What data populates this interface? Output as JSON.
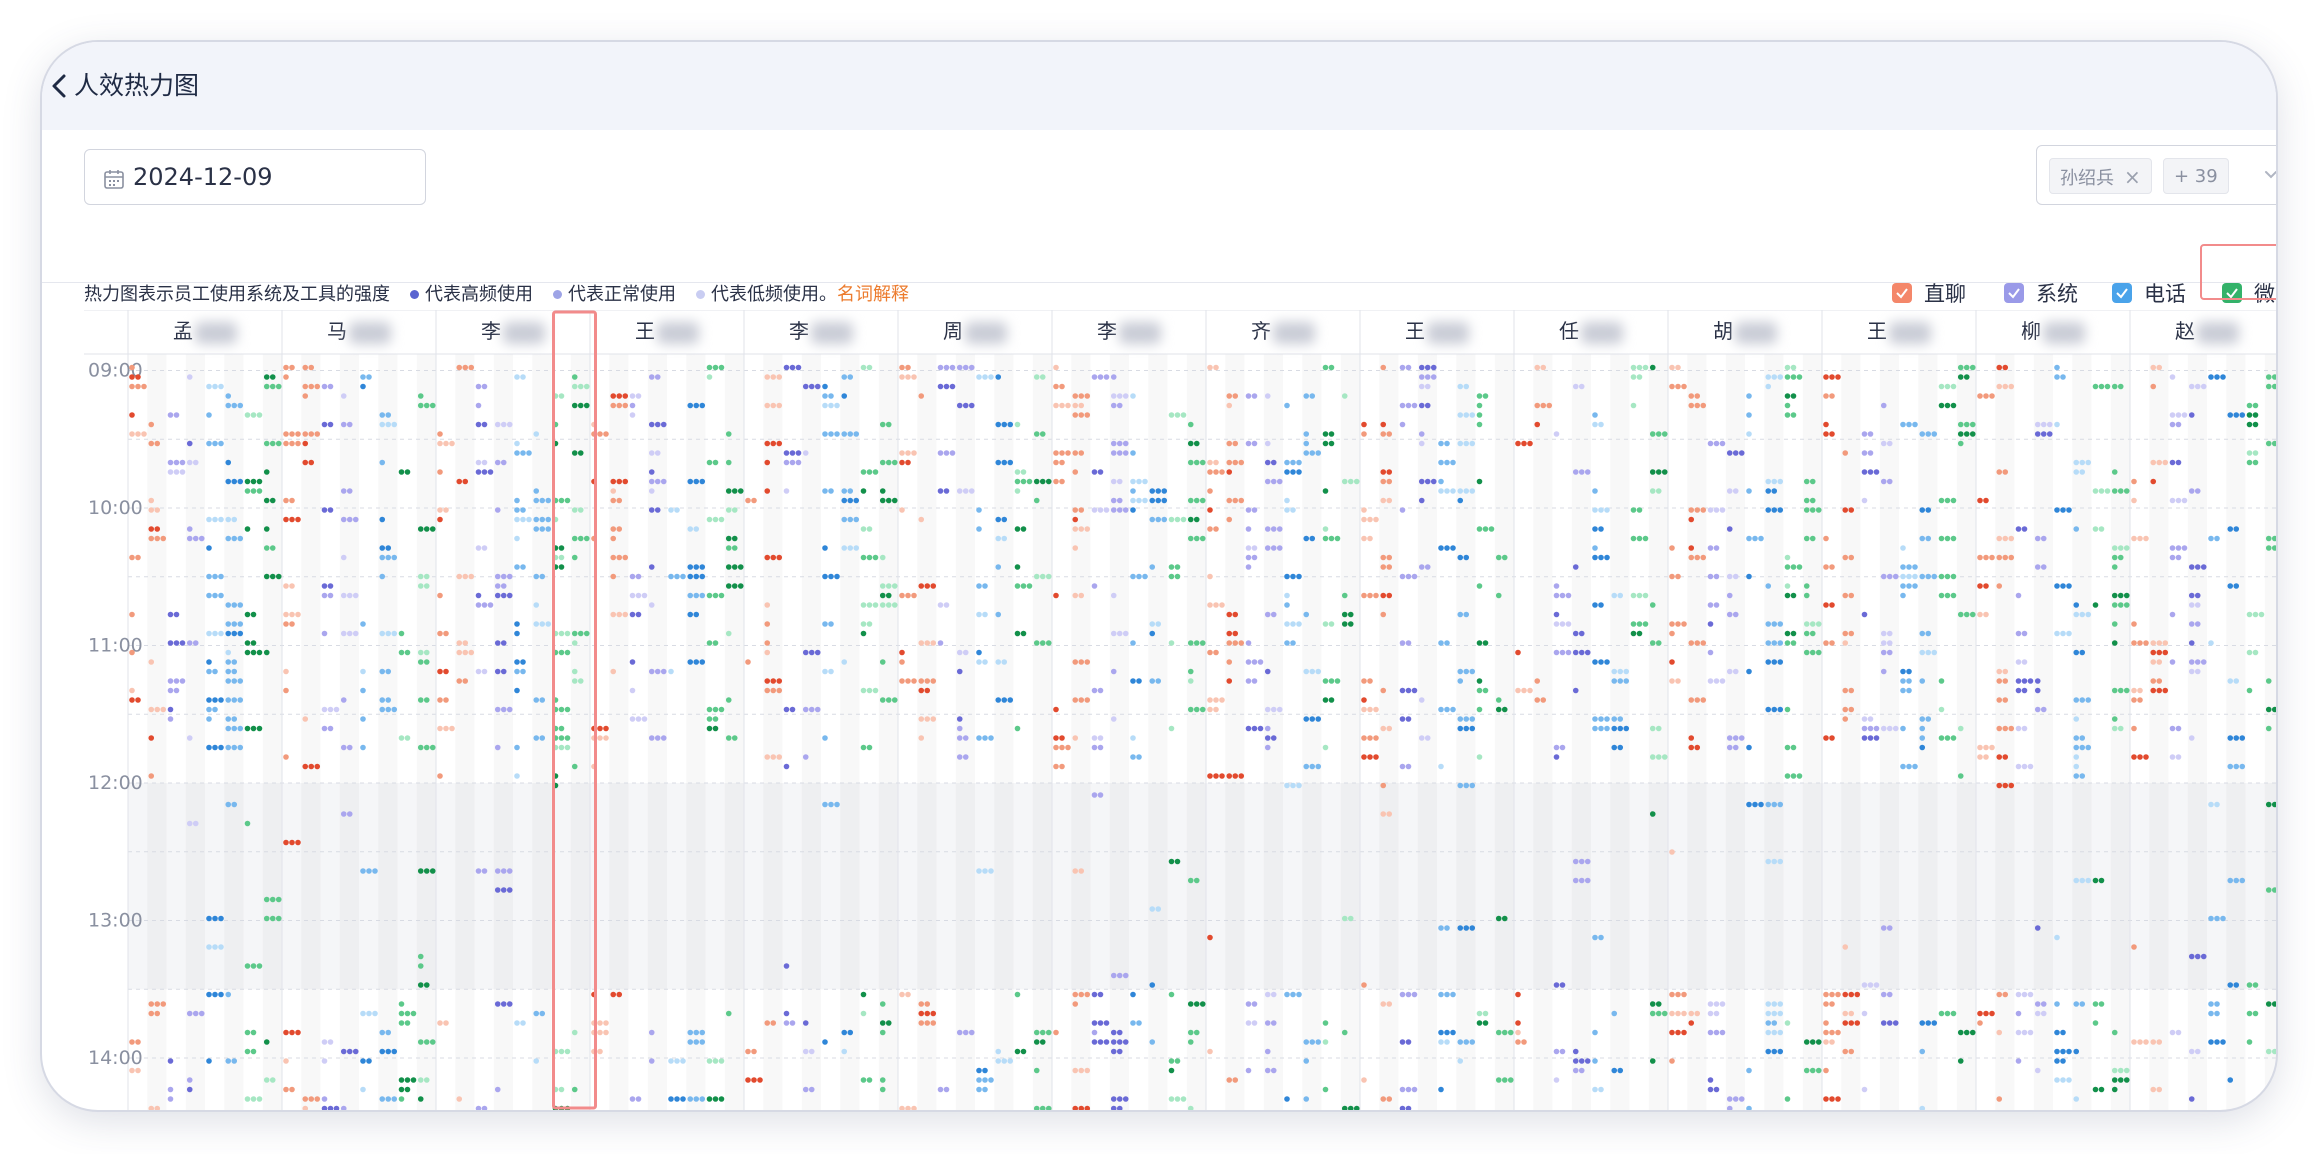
{
  "header": {
    "title": "人效热力图"
  },
  "toolbar": {
    "date": "2024-12-09",
    "staff_filter": {
      "selected_tag": "孙绍兵",
      "more_tag": "+ 39"
    }
  },
  "legend": {
    "intro": "热力图表示员工使用系统及工具的强度",
    "high": "代表高频使用",
    "normal": "代表正常使用",
    "low": "代表低频使用。",
    "term_link": "名词解释"
  },
  "categories": [
    {
      "label": "直聊",
      "color": "#f4876a",
      "checked": true
    },
    {
      "label": "系统",
      "color": "#9a9ae8",
      "checked": true
    },
    {
      "label": "电话",
      "color": "#4aa3ea",
      "checked": true
    },
    {
      "label": "微",
      "color": "#34b26a",
      "checked": true
    }
  ],
  "colors": {
    "legend_high": "#5a64d0",
    "legend_normal": "#9ea4e6",
    "legend_low": "#c9cdf2",
    "highlight_border": "#f28b8b",
    "link": "#ec7b2d"
  },
  "chart_data": {
    "type": "heatmap",
    "title": "",
    "y_ticks": [
      "09:00",
      "10:00",
      "11:00",
      "12:00",
      "13:00",
      "14:00"
    ],
    "time_range_hours": [
      8.88,
      14.4
    ],
    "idle_band_hours": [
      12.0,
      13.5
    ],
    "highlighted_column": {
      "employee_index": 2,
      "category": "微"
    },
    "employees": [
      {
        "name_prefix": "孟",
        "blurred": true
      },
      {
        "name_prefix": "马",
        "blurred": true
      },
      {
        "name_prefix": "李",
        "blurred": true
      },
      {
        "name_prefix": "王",
        "blurred": true
      },
      {
        "name_prefix": "李",
        "blurred": true
      },
      {
        "name_prefix": "周",
        "blurred": true
      },
      {
        "name_prefix": "李",
        "blurred": true
      },
      {
        "name_prefix": "齐",
        "blurred": true
      },
      {
        "name_prefix": "王",
        "blurred": true
      },
      {
        "name_prefix": "任",
        "blurred": true
      },
      {
        "name_prefix": "胡",
        "blurred": true
      },
      {
        "name_prefix": "王",
        "blurred": true
      },
      {
        "name_prefix": "柳",
        "blurred": true
      },
      {
        "name_prefix": "赵",
        "blurred": true
      }
    ],
    "sub_columns": [
      "直聊",
      "直聊",
      "系统",
      "系统",
      "电话",
      "电话",
      "微",
      "微"
    ],
    "intensity_levels": [
      "high",
      "normal",
      "low"
    ],
    "palettes": {
      "直聊": [
        "#e24a2e",
        "#f29a7c",
        "#f9c4b2"
      ],
      "系统": [
        "#6a6ad6",
        "#aaa6ee",
        "#cfcdf6"
      ],
      "电话": [
        "#2f86d8",
        "#78b8ee",
        "#b7dcf8"
      ],
      "微": [
        "#12904a",
        "#5cc98a",
        "#a6e7c3"
      ]
    },
    "activity_hint": "dense usage 09:00–11:45 and 13:30–14:30; sparse over the 12:00–13:30 lunch band"
  }
}
